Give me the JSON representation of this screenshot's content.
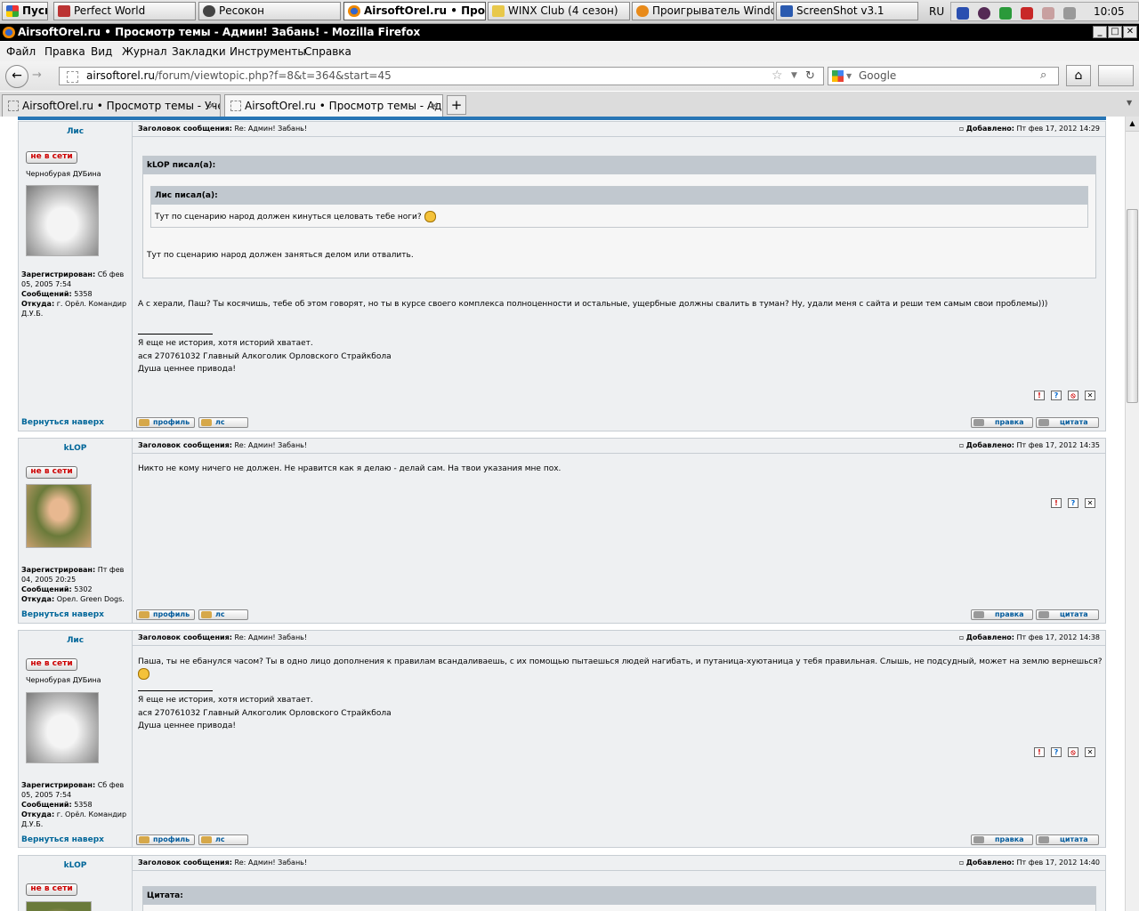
{
  "taskbar": {
    "start": "Пуск",
    "items": [
      "Perfect World",
      "Ресокон",
      "AirsoftOrel.ru • Прос...",
      "WINX Club (4 сезон)",
      "Проигрыватель Windo...",
      "ScreenShot v3.1"
    ],
    "lang": "RU",
    "clock": "10:05"
  },
  "window": {
    "title": "AirsoftOrel.ru • Просмотр темы - Админ! Забань! - Mozilla Firefox",
    "min": "_",
    "max": "□",
    "close": "✕"
  },
  "menu": [
    "Файл",
    "Правка",
    "Вид",
    "Журнал",
    "Закладки",
    "Инструменты",
    "Справка"
  ],
  "nav": {
    "url_host": "airsoftorel.ru",
    "url_path": "/forum/viewtopic.php?f=8&t=364&start=45",
    "search_placeholder": "Google"
  },
  "tabs": [
    "AirsoftOrel.ru • Просмотр темы - Учет п...",
    "AirsoftOrel.ru • Просмотр темы - Админ..."
  ],
  "labels": {
    "subject": "Заголовок сообщения:",
    "added": "Добавлено:",
    "offline": "не в сети",
    "back_top": "Вернуться наверх",
    "profile": "профиль",
    "pm": "лс",
    "edit": "правка",
    "quote": "цитата",
    "registered": "Зарегистрирован:",
    "posts": "Сообщений:",
    "from": "Откуда:"
  },
  "posts": [
    {
      "author": "Лис",
      "rank": "Чернобурая ДУБина",
      "subject": "Re: Админ! Забань!",
      "date": "Пт фев 17, 2012 14:29",
      "reg": "Сб фев 05, 2005 7:54",
      "count": "5358",
      "from": "г. Орёл. Командир Д.У.Б.",
      "outer_quote_title": "kLOP писал(а):",
      "inner_quote_title": "Лис писал(а):",
      "inner_quote_text": "Тут по сценарию народ должен кинуться целовать тебе ноги?",
      "outer_quote_text": "Тут по сценарию народ должен заняться делом или отвалить.",
      "text": "А с херали, Паш? Ты косячишь, тебе об этом говорят, но ты в курсе своего комплекса полноценности и остальные, ущербные должны свалить в туман? Ну, удали меня с сайта и реши тем самым свои проблемы)))",
      "sig1": "Я еще не история, хотя историй хватает.",
      "sig2": "ася 270761032 Главный Алкоголик Орловского Страйкбола",
      "sig3": "Душа ценнее привода!"
    },
    {
      "author": "kLOP",
      "subject": "Re: Админ! Забань!",
      "date": "Пт фев 17, 2012 14:35",
      "reg": "Пт фев 04, 2005 20:25",
      "count": "5302",
      "from": "Орел. Green Dogs.",
      "text": "Никто не кому ничего не должен. Не нравится как я делаю - делай сам. На твои указания мне пох."
    },
    {
      "author": "Лис",
      "rank": "Чернобурая ДУБина",
      "subject": "Re: Админ! Забань!",
      "date": "Пт фев 17, 2012 14:38",
      "reg": "Сб фев 05, 2005 7:54",
      "count": "5358",
      "from": "г. Орёл. Командир Д.У.Б.",
      "text": "Паша, ты не ебанулся часом? Ты в одно лицо дополнения к правилам всандаливаешь, с их помощью пытаешься людей нагибать, и путаница-хуютаница у тебя правильная. Слышь, не подсудный, может на землю вернешься?",
      "sig1": "Я еще не история, хотя историй хватает.",
      "sig2": "ася 270761032 Главный Алкоголик Орловского Страйкбола",
      "sig3": "Душа ценнее привода!"
    },
    {
      "author": "kLOP",
      "subject": "Re: Админ! Забань!",
      "date": "Пт фев 17, 2012 14:40",
      "quote_title": "Цитата:"
    }
  ]
}
